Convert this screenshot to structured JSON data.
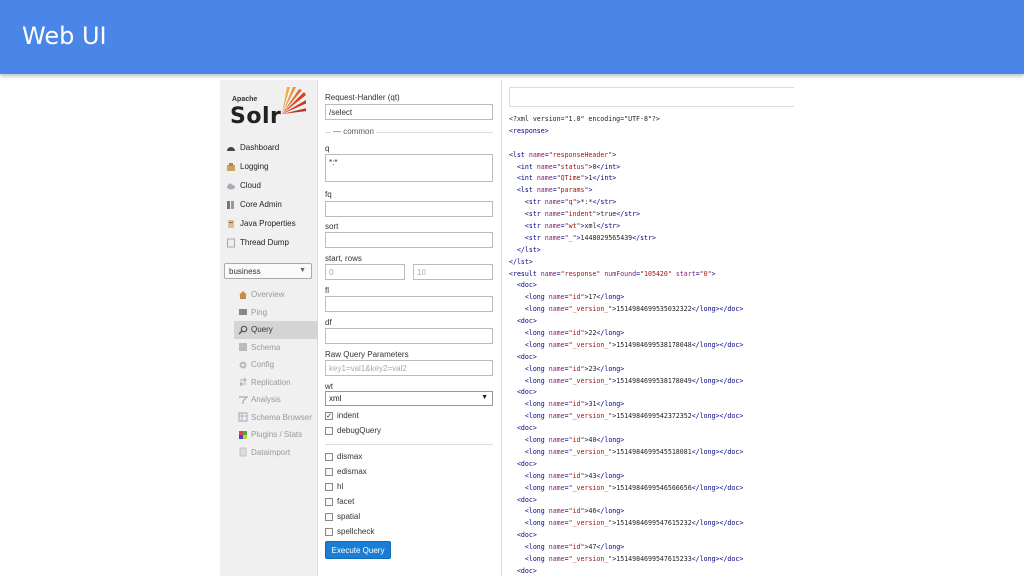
{
  "slide": {
    "title": "Web UI"
  },
  "logo": {
    "apache": "Apache",
    "solr": "Solr"
  },
  "nav": [
    {
      "label": "Dashboard",
      "icon": "dashboard-icon"
    },
    {
      "label": "Logging",
      "icon": "logging-icon"
    },
    {
      "label": "Cloud",
      "icon": "cloud-icon"
    },
    {
      "label": "Core Admin",
      "icon": "core-admin-icon"
    },
    {
      "label": "Java Properties",
      "icon": "java-properties-icon"
    },
    {
      "label": "Thread Dump",
      "icon": "thread-dump-icon"
    }
  ],
  "core_selector": {
    "value": "business"
  },
  "core_menu": [
    {
      "label": "Overview",
      "icon": "overview-icon",
      "active": false
    },
    {
      "label": "Ping",
      "icon": "ping-icon",
      "active": false
    },
    {
      "label": "Query",
      "icon": "query-icon",
      "active": true
    },
    {
      "label": "Schema",
      "icon": "schema-icon",
      "active": false
    },
    {
      "label": "Config",
      "icon": "config-icon",
      "active": false
    },
    {
      "label": "Replication",
      "icon": "replication-icon",
      "active": false
    },
    {
      "label": "Analysis",
      "icon": "analysis-icon",
      "active": false
    },
    {
      "label": "Schema Browser",
      "icon": "schema-browser-icon",
      "active": false
    },
    {
      "label": "Plugins / Stats",
      "icon": "plugins-stats-icon",
      "active": false
    },
    {
      "label": "Dataimport",
      "icon": "dataimport-icon",
      "active": false
    }
  ],
  "form": {
    "request_handler_label": "Request-Handler (qt)",
    "request_handler_value": "/select",
    "common_section": "common",
    "q_label": "q",
    "q_value": "*:*",
    "fq_label": "fq",
    "sort_label": "sort",
    "start_rows_label": "start, rows",
    "start_placeholder": "0",
    "rows_placeholder": "10",
    "fl_label": "fl",
    "df_label": "df",
    "raw_params_label": "Raw Query Parameters",
    "raw_params_placeholder": "key1=val1&key2=val2",
    "wt_label": "wt",
    "wt_value": "xml",
    "indent_label": "indent",
    "indent_checked": true,
    "debug_label": "debugQuery",
    "extras": [
      "dismax",
      "edismax",
      "hl",
      "facet",
      "spatial",
      "spellcheck"
    ],
    "execute_label": "Execute Query"
  },
  "response_lines": [
    [
      [
        "pi",
        "<?xml version=\"1.0\" encoding=\"UTF-8\"?>"
      ]
    ],
    [
      [
        "tg",
        "<response>"
      ]
    ],
    [],
    [
      [
        "tg",
        "<lst "
      ],
      [
        "an",
        "name"
      ],
      [
        "tg",
        "="
      ],
      [
        "av",
        "\"responseHeader\""
      ],
      [
        "tg",
        ">"
      ]
    ],
    [
      [
        "tx",
        "  "
      ],
      [
        "tg",
        "<int "
      ],
      [
        "an",
        "name"
      ],
      [
        "tg",
        "="
      ],
      [
        "av",
        "\"status\""
      ],
      [
        "tg",
        ">"
      ],
      [
        "tx",
        "0"
      ],
      [
        "tg",
        "</int>"
      ]
    ],
    [
      [
        "tx",
        "  "
      ],
      [
        "tg",
        "<int "
      ],
      [
        "an",
        "name"
      ],
      [
        "tg",
        "="
      ],
      [
        "av",
        "\"QTime\""
      ],
      [
        "tg",
        ">"
      ],
      [
        "tx",
        "1"
      ],
      [
        "tg",
        "</int>"
      ]
    ],
    [
      [
        "tx",
        "  "
      ],
      [
        "tg",
        "<lst "
      ],
      [
        "an",
        "name"
      ],
      [
        "tg",
        "="
      ],
      [
        "av",
        "\"params\""
      ],
      [
        "tg",
        ">"
      ]
    ],
    [
      [
        "tx",
        "    "
      ],
      [
        "tg",
        "<str "
      ],
      [
        "an",
        "name"
      ],
      [
        "tg",
        "="
      ],
      [
        "av",
        "\"q\""
      ],
      [
        "tg",
        ">"
      ],
      [
        "tx",
        "*:*"
      ],
      [
        "tg",
        "</str>"
      ]
    ],
    [
      [
        "tx",
        "    "
      ],
      [
        "tg",
        "<str "
      ],
      [
        "an",
        "name"
      ],
      [
        "tg",
        "="
      ],
      [
        "av",
        "\"indent\""
      ],
      [
        "tg",
        ">"
      ],
      [
        "tx",
        "true"
      ],
      [
        "tg",
        "</str>"
      ]
    ],
    [
      [
        "tx",
        "    "
      ],
      [
        "tg",
        "<str "
      ],
      [
        "an",
        "name"
      ],
      [
        "tg",
        "="
      ],
      [
        "av",
        "\"wt\""
      ],
      [
        "tg",
        ">"
      ],
      [
        "tx",
        "xml"
      ],
      [
        "tg",
        "</str>"
      ]
    ],
    [
      [
        "tx",
        "    "
      ],
      [
        "tg",
        "<str "
      ],
      [
        "an",
        "name"
      ],
      [
        "tg",
        "="
      ],
      [
        "av",
        "\"_\""
      ],
      [
        "tg",
        ">"
      ],
      [
        "tx",
        "1448029565439"
      ],
      [
        "tg",
        "</str>"
      ]
    ],
    [
      [
        "tx",
        "  "
      ],
      [
        "tg",
        "</lst>"
      ]
    ],
    [
      [
        "tg",
        "</lst>"
      ]
    ],
    [
      [
        "tg",
        "<result "
      ],
      [
        "an",
        "name"
      ],
      [
        "tg",
        "="
      ],
      [
        "av",
        "\"response\""
      ],
      [
        "tg",
        " "
      ],
      [
        "an",
        "numFound"
      ],
      [
        "tg",
        "="
      ],
      [
        "av",
        "\"105420\""
      ],
      [
        "tg",
        " "
      ],
      [
        "an",
        "start"
      ],
      [
        "tg",
        "="
      ],
      [
        "av",
        "\"0\""
      ],
      [
        "tg",
        ">"
      ]
    ],
    [
      [
        "tx",
        "  "
      ],
      [
        "tg",
        "<doc>"
      ]
    ],
    [
      [
        "tx",
        "    "
      ],
      [
        "tg",
        "<long "
      ],
      [
        "an",
        "name"
      ],
      [
        "tg",
        "="
      ],
      [
        "av",
        "\"id\""
      ],
      [
        "tg",
        ">"
      ],
      [
        "tx",
        "17"
      ],
      [
        "tg",
        "</long>"
      ]
    ],
    [
      [
        "tx",
        "    "
      ],
      [
        "tg",
        "<long "
      ],
      [
        "an",
        "name"
      ],
      [
        "tg",
        "="
      ],
      [
        "av",
        "\"_version_\""
      ],
      [
        "tg",
        ">"
      ],
      [
        "tx",
        "1514984699535032322"
      ],
      [
        "tg",
        "</long></doc>"
      ]
    ],
    [
      [
        "tx",
        "  "
      ],
      [
        "tg",
        "<doc>"
      ]
    ],
    [
      [
        "tx",
        "    "
      ],
      [
        "tg",
        "<long "
      ],
      [
        "an",
        "name"
      ],
      [
        "tg",
        "="
      ],
      [
        "av",
        "\"id\""
      ],
      [
        "tg",
        ">"
      ],
      [
        "tx",
        "22"
      ],
      [
        "tg",
        "</long>"
      ]
    ],
    [
      [
        "tx",
        "    "
      ],
      [
        "tg",
        "<long "
      ],
      [
        "an",
        "name"
      ],
      [
        "tg",
        "="
      ],
      [
        "av",
        "\"_version_\""
      ],
      [
        "tg",
        ">"
      ],
      [
        "tx",
        "1514984699538178048"
      ],
      [
        "tg",
        "</long></doc>"
      ]
    ],
    [
      [
        "tx",
        "  "
      ],
      [
        "tg",
        "<doc>"
      ]
    ],
    [
      [
        "tx",
        "    "
      ],
      [
        "tg",
        "<long "
      ],
      [
        "an",
        "name"
      ],
      [
        "tg",
        "="
      ],
      [
        "av",
        "\"id\""
      ],
      [
        "tg",
        ">"
      ],
      [
        "tx",
        "23"
      ],
      [
        "tg",
        "</long>"
      ]
    ],
    [
      [
        "tx",
        "    "
      ],
      [
        "tg",
        "<long "
      ],
      [
        "an",
        "name"
      ],
      [
        "tg",
        "="
      ],
      [
        "av",
        "\"_version_\""
      ],
      [
        "tg",
        ">"
      ],
      [
        "tx",
        "1514984699538178049"
      ],
      [
        "tg",
        "</long></doc>"
      ]
    ],
    [
      [
        "tx",
        "  "
      ],
      [
        "tg",
        "<doc>"
      ]
    ],
    [
      [
        "tx",
        "    "
      ],
      [
        "tg",
        "<long "
      ],
      [
        "an",
        "name"
      ],
      [
        "tg",
        "="
      ],
      [
        "av",
        "\"id\""
      ],
      [
        "tg",
        ">"
      ],
      [
        "tx",
        "31"
      ],
      [
        "tg",
        "</long>"
      ]
    ],
    [
      [
        "tx",
        "    "
      ],
      [
        "tg",
        "<long "
      ],
      [
        "an",
        "name"
      ],
      [
        "tg",
        "="
      ],
      [
        "av",
        "\"_version_\""
      ],
      [
        "tg",
        ">"
      ],
      [
        "tx",
        "1514984699542372352"
      ],
      [
        "tg",
        "</long></doc>"
      ]
    ],
    [
      [
        "tx",
        "  "
      ],
      [
        "tg",
        "<doc>"
      ]
    ],
    [
      [
        "tx",
        "    "
      ],
      [
        "tg",
        "<long "
      ],
      [
        "an",
        "name"
      ],
      [
        "tg",
        "="
      ],
      [
        "av",
        "\"id\""
      ],
      [
        "tg",
        ">"
      ],
      [
        "tx",
        "40"
      ],
      [
        "tg",
        "</long>"
      ]
    ],
    [
      [
        "tx",
        "    "
      ],
      [
        "tg",
        "<long "
      ],
      [
        "an",
        "name"
      ],
      [
        "tg",
        "="
      ],
      [
        "av",
        "\"_version_\""
      ],
      [
        "tg",
        ">"
      ],
      [
        "tx",
        "1514984699545518081"
      ],
      [
        "tg",
        "</long></doc>"
      ]
    ],
    [
      [
        "tx",
        "  "
      ],
      [
        "tg",
        "<doc>"
      ]
    ],
    [
      [
        "tx",
        "    "
      ],
      [
        "tg",
        "<long "
      ],
      [
        "an",
        "name"
      ],
      [
        "tg",
        "="
      ],
      [
        "av",
        "\"id\""
      ],
      [
        "tg",
        ">"
      ],
      [
        "tx",
        "43"
      ],
      [
        "tg",
        "</long>"
      ]
    ],
    [
      [
        "tx",
        "    "
      ],
      [
        "tg",
        "<long "
      ],
      [
        "an",
        "name"
      ],
      [
        "tg",
        "="
      ],
      [
        "av",
        "\"_version_\""
      ],
      [
        "tg",
        ">"
      ],
      [
        "tx",
        "1514984699546566656"
      ],
      [
        "tg",
        "</long></doc>"
      ]
    ],
    [
      [
        "tx",
        "  "
      ],
      [
        "tg",
        "<doc>"
      ]
    ],
    [
      [
        "tx",
        "    "
      ],
      [
        "tg",
        "<long "
      ],
      [
        "an",
        "name"
      ],
      [
        "tg",
        "="
      ],
      [
        "av",
        "\"id\""
      ],
      [
        "tg",
        ">"
      ],
      [
        "tx",
        "46"
      ],
      [
        "tg",
        "</long>"
      ]
    ],
    [
      [
        "tx",
        "    "
      ],
      [
        "tg",
        "<long "
      ],
      [
        "an",
        "name"
      ],
      [
        "tg",
        "="
      ],
      [
        "av",
        "\"_version_\""
      ],
      [
        "tg",
        ">"
      ],
      [
        "tx",
        "1514984699547615232"
      ],
      [
        "tg",
        "</long></doc>"
      ]
    ],
    [
      [
        "tx",
        "  "
      ],
      [
        "tg",
        "<doc>"
      ]
    ],
    [
      [
        "tx",
        "    "
      ],
      [
        "tg",
        "<long "
      ],
      [
        "an",
        "name"
      ],
      [
        "tg",
        "="
      ],
      [
        "av",
        "\"id\""
      ],
      [
        "tg",
        ">"
      ],
      [
        "tx",
        "47"
      ],
      [
        "tg",
        "</long>"
      ]
    ],
    [
      [
        "tx",
        "    "
      ],
      [
        "tg",
        "<long "
      ],
      [
        "an",
        "name"
      ],
      [
        "tg",
        "="
      ],
      [
        "av",
        "\"_version_\""
      ],
      [
        "tg",
        ">"
      ],
      [
        "tx",
        "1514984699547615233"
      ],
      [
        "tg",
        "</long></doc>"
      ]
    ],
    [
      [
        "tx",
        "  "
      ],
      [
        "tg",
        "<doc>"
      ]
    ]
  ],
  "colors": {
    "header_bg": "#4a86e8",
    "execute_button": "#1a7fd4",
    "xml_tag": "#000080",
    "xml_attr_name": "#7d1d6b",
    "xml_attr_value": "#a31515"
  }
}
